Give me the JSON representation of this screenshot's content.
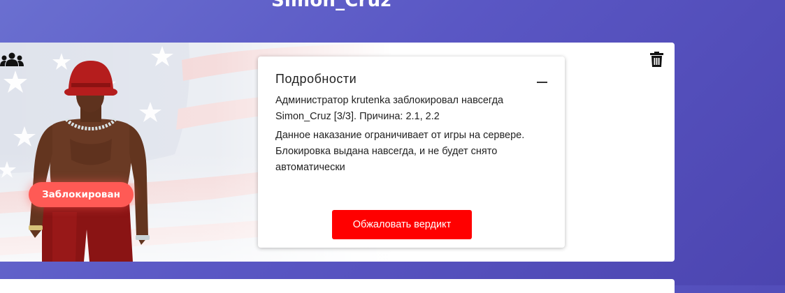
{
  "profile": {
    "player_name": "Simon_Cruz"
  },
  "card": {
    "status_badge": "Заблокирован",
    "details": {
      "title": "Подробности",
      "text_1": "Администратор krutenka заблокировал навсегда Simon_Cruz [3/3]. Причина: 2.1, 2.2",
      "text_2": "Данное наказание ограничивает от игры на сервере. Блокировка выдана навсегда, и не будет снято автоматически",
      "appeal_button": "Обжаловать вердикт"
    }
  },
  "icons": {
    "group": "users-icon",
    "delete": "trash-icon",
    "collapse": "minus-icon"
  },
  "colors": {
    "background": "#5a57c4",
    "badge": "#ff5a55",
    "appeal_button": "#ff0000"
  }
}
